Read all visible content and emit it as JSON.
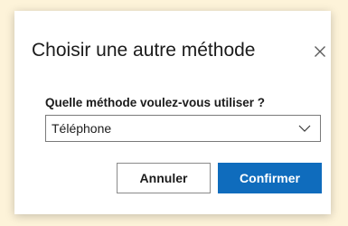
{
  "dialog": {
    "title": "Choisir une autre méthode",
    "close_icon": "close-icon",
    "field_label": "Quelle méthode voulez-vous utiliser ?",
    "select": {
      "selected_value": "Téléphone",
      "chevron_icon": "chevron-down-icon"
    },
    "buttons": {
      "cancel_label": "Annuler",
      "confirm_label": "Confirmer"
    }
  },
  "colors": {
    "backdrop": "#fdf3d9",
    "primary": "#0f6cbd",
    "text": "#1b1b1b"
  }
}
